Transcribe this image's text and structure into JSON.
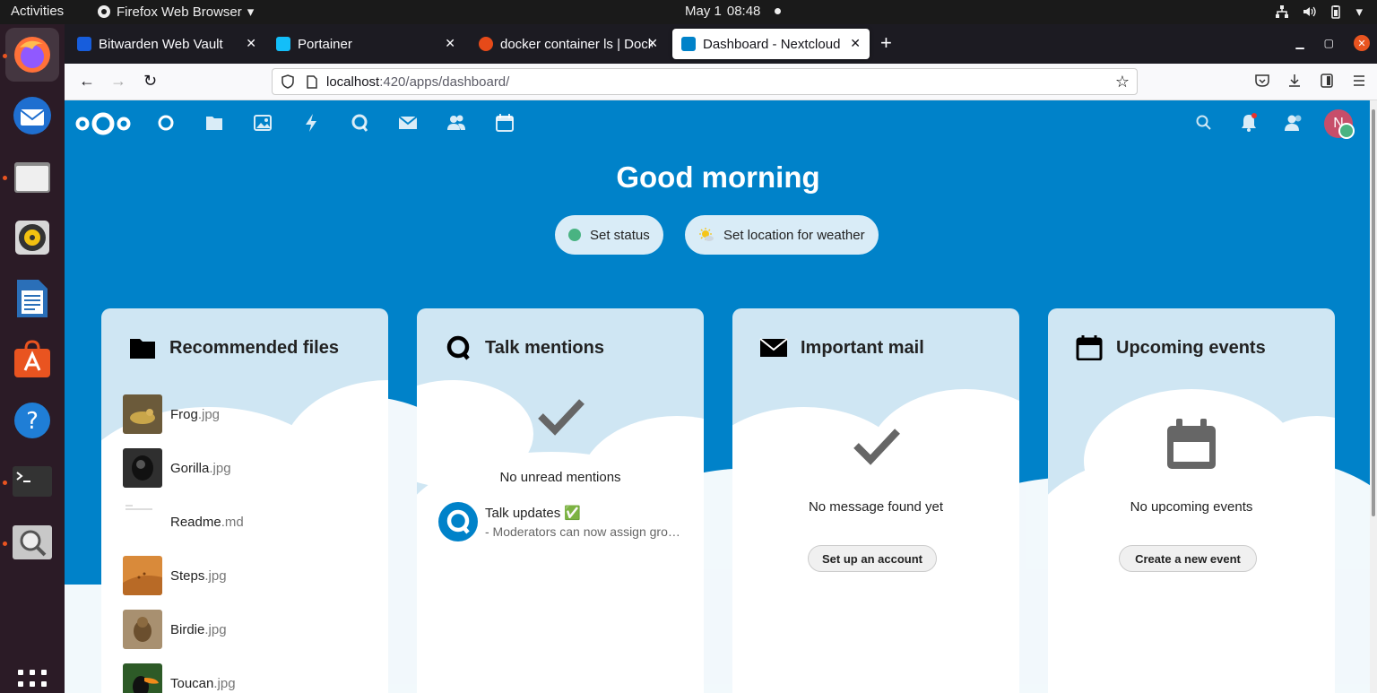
{
  "system": {
    "activities_label": "Activities",
    "app_menu_label": "Firefox Web Browser",
    "date": "May 1",
    "time": "08:48"
  },
  "tabs": [
    {
      "title": "Bitwarden Web Vault",
      "favicon_color": "#175ddc"
    },
    {
      "title": "Portainer",
      "favicon_color": "#13bef9"
    },
    {
      "title": "docker container ls | Docker",
      "favicon_color": "#e64a19"
    },
    {
      "title": "Dashboard - Nextcloud",
      "favicon_color": "#0082c9"
    }
  ],
  "url": {
    "host": "localhost",
    "path": ":420/apps/dashboard/"
  },
  "nextcloud": {
    "brand_color": "#0082c9",
    "avatar_letter": "N",
    "greeting": "Good morning",
    "set_status_label": "Set status",
    "set_weather_label": "Set location for weather",
    "panels": {
      "files": {
        "title": "Recommended files",
        "items": [
          {
            "name": "Frog",
            "ext": ".jpg"
          },
          {
            "name": "Gorilla",
            "ext": ".jpg"
          },
          {
            "name": "Readme",
            "ext": ".md"
          },
          {
            "name": "Steps",
            "ext": ".jpg"
          },
          {
            "name": "Birdie",
            "ext": ".jpg"
          },
          {
            "name": "Toucan",
            "ext": ".jpg"
          }
        ]
      },
      "talk": {
        "title": "Talk mentions",
        "empty_text": "No unread mentions",
        "item_title": "Talk updates ✅",
        "item_sub": "- Moderators can now assign groups and other moderators"
      },
      "mail": {
        "title": "Important mail",
        "empty_text": "No message found yet",
        "button_label": "Set up an account"
      },
      "events": {
        "title": "Upcoming events",
        "empty_text": "No upcoming events",
        "button_label": "Create a new event"
      }
    }
  }
}
